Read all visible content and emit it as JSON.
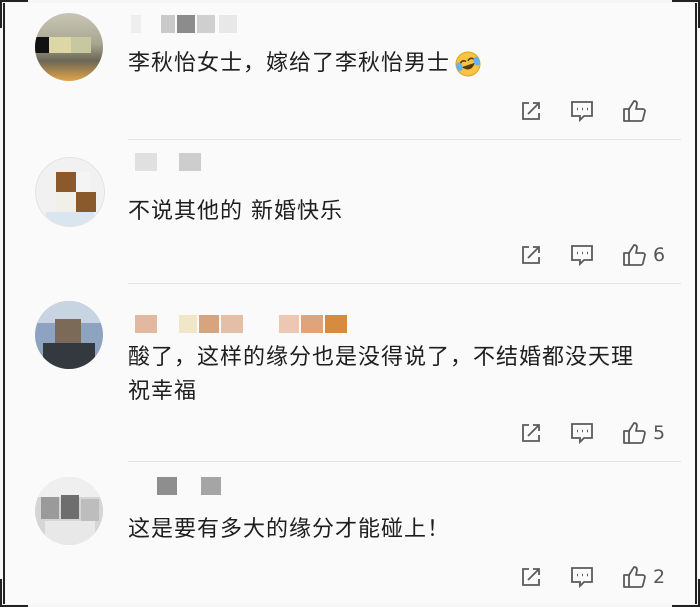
{
  "comments": [
    {
      "text": "李秋怡女士，嫁给了李秋怡男士",
      "like_count": ""
    },
    {
      "text": "不说其他的 新婚快乐",
      "like_count": "6"
    },
    {
      "text": "酸了，这样的缘分也是没得说了，不结婚都没天理祝幸福",
      "like_count": "5"
    },
    {
      "text": "这是要有多大的缘分才能碰上！",
      "like_count": "2"
    }
  ],
  "icons": {
    "share": "share-icon",
    "reply": "reply-comment-icon",
    "like": "thumbs-up-icon",
    "emoji": "laughing-crying-emoji"
  },
  "colors": {
    "text": "#1e1e1e",
    "icon": "#5a5a5a",
    "divider": "#e4e4e4",
    "background": "#fafafa"
  }
}
